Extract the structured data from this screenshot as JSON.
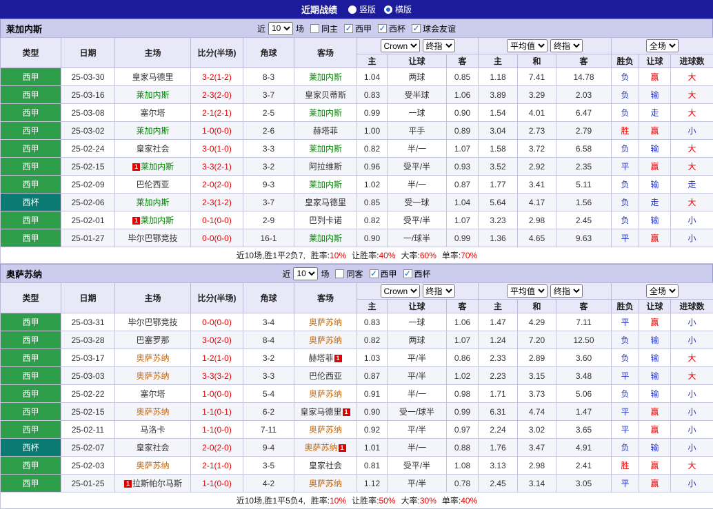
{
  "topbar": {
    "title": "近期战绩",
    "view_options": [
      {
        "label": "竖版",
        "selected": false
      },
      {
        "label": "横版",
        "selected": true
      }
    ]
  },
  "colors": {
    "topbar": "#1b1b9c",
    "league": {
      "西甲": "#2e9e4a",
      "西杯": "#0a7a72"
    },
    "score": "#e80000",
    "result_red": "#e80000",
    "result_blue": "#2233cc",
    "badge": "#e00000",
    "summary_value": "#e80000"
  },
  "table_header": {
    "static_cols": [
      "类型",
      "日期",
      "主场",
      "比分(半场)",
      "角球",
      "客场"
    ],
    "asian_selects": [
      "Crown",
      "终指"
    ],
    "asian_cols": [
      "主",
      "让球",
      "客"
    ],
    "euro_selects": [
      "平均值",
      "终指"
    ],
    "euro_cols": [
      "主",
      "和",
      "客"
    ],
    "result_selects": [
      "全场"
    ],
    "result_cols": [
      "胜负",
      "让球",
      "进球数"
    ]
  },
  "sections": [
    {
      "team": "莱加内斯",
      "team_color": "#008800",
      "filters": {
        "prefix": "近",
        "count": "10",
        "suffix": "场",
        "checkboxes": [
          {
            "label": "同主",
            "checked": false
          },
          {
            "label": "西甲",
            "checked": true
          },
          {
            "label": "西杯",
            "checked": true
          },
          {
            "label": "球会友谊",
            "checked": true
          }
        ]
      },
      "rows": [
        {
          "league": "西甲",
          "date": "25-03-30",
          "home": "皇家马德里",
          "home_tracked": false,
          "home_badge": "",
          "home_badge_side": "",
          "score": "3-2(1-2)",
          "corners": "8-3",
          "away": "莱加内斯",
          "away_tracked": true,
          "away_badge": "",
          "away_badge_side": "",
          "asian": [
            "1.04",
            "两球",
            "0.85"
          ],
          "euro": [
            "1.18",
            "7.41",
            "14.78"
          ],
          "results": [
            [
              "负",
              "b"
            ],
            [
              "赢",
              "r"
            ],
            [
              "大",
              "r"
            ]
          ]
        },
        {
          "league": "西甲",
          "date": "25-03-16",
          "home": "莱加内斯",
          "home_tracked": true,
          "home_badge": "",
          "home_badge_side": "",
          "score": "2-3(2-0)",
          "corners": "3-7",
          "away": "皇家贝蒂斯",
          "away_tracked": false,
          "away_badge": "",
          "away_badge_side": "",
          "asian": [
            "0.83",
            "受半球",
            "1.06"
          ],
          "euro": [
            "3.89",
            "3.29",
            "2.03"
          ],
          "results": [
            [
              "负",
              "b"
            ],
            [
              "输",
              "b"
            ],
            [
              "大",
              "r"
            ]
          ]
        },
        {
          "league": "西甲",
          "date": "25-03-08",
          "home": "塞尔塔",
          "home_tracked": false,
          "home_badge": "",
          "home_badge_side": "",
          "score": "2-1(2-1)",
          "corners": "2-5",
          "away": "莱加内斯",
          "away_tracked": true,
          "away_badge": "",
          "away_badge_side": "",
          "asian": [
            "0.99",
            "一球",
            "0.90"
          ],
          "euro": [
            "1.54",
            "4.01",
            "6.47"
          ],
          "results": [
            [
              "负",
              "b"
            ],
            [
              "走",
              "b"
            ],
            [
              "大",
              "r"
            ]
          ]
        },
        {
          "league": "西甲",
          "date": "25-03-02",
          "home": "莱加内斯",
          "home_tracked": true,
          "home_badge": "",
          "home_badge_side": "",
          "score": "1-0(0-0)",
          "corners": "2-6",
          "away": "赫塔菲",
          "away_tracked": false,
          "away_badge": "",
          "away_badge_side": "",
          "asian": [
            "1.00",
            "平手",
            "0.89"
          ],
          "euro": [
            "3.04",
            "2.73",
            "2.79"
          ],
          "results": [
            [
              "胜",
              "r"
            ],
            [
              "赢",
              "r"
            ],
            [
              "小",
              "b"
            ]
          ]
        },
        {
          "league": "西甲",
          "date": "25-02-24",
          "home": "皇家社会",
          "home_tracked": false,
          "home_badge": "",
          "home_badge_side": "",
          "score": "3-0(1-0)",
          "corners": "3-3",
          "away": "莱加内斯",
          "away_tracked": true,
          "away_badge": "",
          "away_badge_side": "",
          "asian": [
            "0.82",
            "半/一",
            "1.07"
          ],
          "euro": [
            "1.58",
            "3.72",
            "6.58"
          ],
          "results": [
            [
              "负",
              "b"
            ],
            [
              "输",
              "b"
            ],
            [
              "大",
              "r"
            ]
          ]
        },
        {
          "league": "西甲",
          "date": "25-02-15",
          "home": "莱加内斯",
          "home_tracked": true,
          "home_badge": "1",
          "home_badge_side": "l",
          "score": "3-3(2-1)",
          "corners": "3-2",
          "away": "阿拉维斯",
          "away_tracked": false,
          "away_badge": "",
          "away_badge_side": "",
          "asian": [
            "0.96",
            "受平/半",
            "0.93"
          ],
          "euro": [
            "3.52",
            "2.92",
            "2.35"
          ],
          "results": [
            [
              "平",
              "b"
            ],
            [
              "赢",
              "r"
            ],
            [
              "大",
              "r"
            ]
          ]
        },
        {
          "league": "西甲",
          "date": "25-02-09",
          "home": "巴伦西亚",
          "home_tracked": false,
          "home_badge": "",
          "home_badge_side": "",
          "score": "2-0(2-0)",
          "corners": "9-3",
          "away": "莱加内斯",
          "away_tracked": true,
          "away_badge": "",
          "away_badge_side": "",
          "asian": [
            "1.02",
            "半/一",
            "0.87"
          ],
          "euro": [
            "1.77",
            "3.41",
            "5.11"
          ],
          "results": [
            [
              "负",
              "b"
            ],
            [
              "输",
              "b"
            ],
            [
              "走",
              "b"
            ]
          ]
        },
        {
          "league": "西杯",
          "date": "25-02-06",
          "home": "莱加内斯",
          "home_tracked": true,
          "home_badge": "",
          "home_badge_side": "",
          "score": "2-3(1-2)",
          "corners": "3-7",
          "away": "皇家马德里",
          "away_tracked": false,
          "away_badge": "",
          "away_badge_side": "",
          "asian": [
            "0.85",
            "受一球",
            "1.04"
          ],
          "euro": [
            "5.64",
            "4.17",
            "1.56"
          ],
          "results": [
            [
              "负",
              "b"
            ],
            [
              "走",
              "b"
            ],
            [
              "大",
              "r"
            ]
          ]
        },
        {
          "league": "西甲",
          "date": "25-02-01",
          "home": "莱加内斯",
          "home_tracked": true,
          "home_badge": "1",
          "home_badge_side": "l",
          "score": "0-1(0-0)",
          "corners": "2-9",
          "away": "巴列卡诺",
          "away_tracked": false,
          "away_badge": "",
          "away_badge_side": "",
          "asian": [
            "0.82",
            "受平/半",
            "1.07"
          ],
          "euro": [
            "3.23",
            "2.98",
            "2.45"
          ],
          "results": [
            [
              "负",
              "b"
            ],
            [
              "输",
              "b"
            ],
            [
              "小",
              "b"
            ]
          ]
        },
        {
          "league": "西甲",
          "date": "25-01-27",
          "home": "毕尔巴鄂竞技",
          "home_tracked": false,
          "home_badge": "",
          "home_badge_side": "",
          "score": "0-0(0-0)",
          "corners": "16-1",
          "away": "莱加内斯",
          "away_tracked": true,
          "away_badge": "",
          "away_badge_side": "",
          "asian": [
            "0.90",
            "一/球半",
            "0.99"
          ],
          "euro": [
            "1.36",
            "4.65",
            "9.63"
          ],
          "results": [
            [
              "平",
              "b"
            ],
            [
              "赢",
              "r"
            ],
            [
              "小",
              "b"
            ]
          ]
        }
      ],
      "summary": {
        "record": "近10场,胜1平2负7,",
        "stats": [
          {
            "label": "胜率:",
            "value": "10%"
          },
          {
            "label": "让胜率:",
            "value": "40%"
          },
          {
            "label": "大率:",
            "value": "60%"
          },
          {
            "label": "单率:",
            "value": "70%"
          }
        ]
      }
    },
    {
      "team": "奥萨苏纳",
      "team_color": "#cc6600",
      "filters": {
        "prefix": "近",
        "count": "10",
        "suffix": "场",
        "checkboxes": [
          {
            "label": "同客",
            "checked": false
          },
          {
            "label": "西甲",
            "checked": true
          },
          {
            "label": "西杯",
            "checked": true
          }
        ]
      },
      "rows": [
        {
          "league": "西甲",
          "date": "25-03-31",
          "home": "毕尔巴鄂竞技",
          "home_tracked": false,
          "home_badge": "",
          "home_badge_side": "",
          "score": "0-0(0-0)",
          "corners": "3-4",
          "away": "奥萨苏纳",
          "away_tracked": true,
          "away_badge": "",
          "away_badge_side": "",
          "asian": [
            "0.83",
            "一球",
            "1.06"
          ],
          "euro": [
            "1.47",
            "4.29",
            "7.11"
          ],
          "results": [
            [
              "平",
              "b"
            ],
            [
              "赢",
              "r"
            ],
            [
              "小",
              "b"
            ]
          ]
        },
        {
          "league": "西甲",
          "date": "25-03-28",
          "home": "巴塞罗那",
          "home_tracked": false,
          "home_badge": "",
          "home_badge_side": "",
          "score": "3-0(2-0)",
          "corners": "8-4",
          "away": "奥萨苏纳",
          "away_tracked": true,
          "away_badge": "",
          "away_badge_side": "",
          "asian": [
            "0.82",
            "两球",
            "1.07"
          ],
          "euro": [
            "1.24",
            "7.20",
            "12.50"
          ],
          "results": [
            [
              "负",
              "b"
            ],
            [
              "输",
              "b"
            ],
            [
              "小",
              "b"
            ]
          ]
        },
        {
          "league": "西甲",
          "date": "25-03-17",
          "home": "奥萨苏纳",
          "home_tracked": true,
          "home_badge": "",
          "home_badge_side": "",
          "score": "1-2(1-0)",
          "corners": "3-2",
          "away": "赫塔菲",
          "away_tracked": false,
          "away_badge": "1",
          "away_badge_side": "r",
          "asian": [
            "1.03",
            "平/半",
            "0.86"
          ],
          "euro": [
            "2.33",
            "2.89",
            "3.60"
          ],
          "results": [
            [
              "负",
              "b"
            ],
            [
              "输",
              "b"
            ],
            [
              "大",
              "r"
            ]
          ]
        },
        {
          "league": "西甲",
          "date": "25-03-03",
          "home": "奥萨苏纳",
          "home_tracked": true,
          "home_badge": "",
          "home_badge_side": "",
          "score": "3-3(3-2)",
          "corners": "3-3",
          "away": "巴伦西亚",
          "away_tracked": false,
          "away_badge": "",
          "away_badge_side": "",
          "asian": [
            "0.87",
            "平/半",
            "1.02"
          ],
          "euro": [
            "2.23",
            "3.15",
            "3.48"
          ],
          "results": [
            [
              "平",
              "b"
            ],
            [
              "输",
              "b"
            ],
            [
              "大",
              "r"
            ]
          ]
        },
        {
          "league": "西甲",
          "date": "25-02-22",
          "home": "塞尔塔",
          "home_tracked": false,
          "home_badge": "",
          "home_badge_side": "",
          "score": "1-0(0-0)",
          "corners": "5-4",
          "away": "奥萨苏纳",
          "away_tracked": true,
          "away_badge": "",
          "away_badge_side": "",
          "asian": [
            "0.91",
            "半/一",
            "0.98"
          ],
          "euro": [
            "1.71",
            "3.73",
            "5.06"
          ],
          "results": [
            [
              "负",
              "b"
            ],
            [
              "输",
              "b"
            ],
            [
              "小",
              "b"
            ]
          ]
        },
        {
          "league": "西甲",
          "date": "25-02-15",
          "home": "奥萨苏纳",
          "home_tracked": true,
          "home_badge": "",
          "home_badge_side": "",
          "score": "1-1(0-1)",
          "corners": "6-2",
          "away": "皇家马德里",
          "away_tracked": false,
          "away_badge": "1",
          "away_badge_side": "r",
          "asian": [
            "0.90",
            "受一/球半",
            "0.99"
          ],
          "euro": [
            "6.31",
            "4.74",
            "1.47"
          ],
          "results": [
            [
              "平",
              "b"
            ],
            [
              "赢",
              "r"
            ],
            [
              "小",
              "b"
            ]
          ]
        },
        {
          "league": "西甲",
          "date": "25-02-11",
          "home": "马洛卡",
          "home_tracked": false,
          "home_badge": "",
          "home_badge_side": "",
          "score": "1-1(0-0)",
          "corners": "7-11",
          "away": "奥萨苏纳",
          "away_tracked": true,
          "away_badge": "",
          "away_badge_side": "",
          "asian": [
            "0.92",
            "平/半",
            "0.97"
          ],
          "euro": [
            "2.24",
            "3.02",
            "3.65"
          ],
          "results": [
            [
              "平",
              "b"
            ],
            [
              "赢",
              "r"
            ],
            [
              "小",
              "b"
            ]
          ]
        },
        {
          "league": "西杯",
          "date": "25-02-07",
          "home": "皇家社会",
          "home_tracked": false,
          "home_badge": "",
          "home_badge_side": "",
          "score": "2-0(2-0)",
          "corners": "9-4",
          "away": "奥萨苏纳",
          "away_tracked": true,
          "away_badge": "1",
          "away_badge_side": "r",
          "asian": [
            "1.01",
            "半/一",
            "0.88"
          ],
          "euro": [
            "1.76",
            "3.47",
            "4.91"
          ],
          "results": [
            [
              "负",
              "b"
            ],
            [
              "输",
              "b"
            ],
            [
              "小",
              "b"
            ]
          ]
        },
        {
          "league": "西甲",
          "date": "25-02-03",
          "home": "奥萨苏纳",
          "home_tracked": true,
          "home_badge": "",
          "home_badge_side": "",
          "score": "2-1(1-0)",
          "corners": "3-5",
          "away": "皇家社会",
          "away_tracked": false,
          "away_badge": "",
          "away_badge_side": "",
          "asian": [
            "0.81",
            "受平/半",
            "1.08"
          ],
          "euro": [
            "3.13",
            "2.98",
            "2.41"
          ],
          "results": [
            [
              "胜",
              "r"
            ],
            [
              "赢",
              "r"
            ],
            [
              "大",
              "r"
            ]
          ]
        },
        {
          "league": "西甲",
          "date": "25-01-25",
          "home": "拉斯帕尔马斯",
          "home_tracked": false,
          "home_badge": "1",
          "home_badge_side": "l",
          "score": "1-1(0-0)",
          "corners": "4-2",
          "away": "奥萨苏纳",
          "away_tracked": true,
          "away_badge": "",
          "away_badge_side": "",
          "asian": [
            "1.12",
            "平/半",
            "0.78"
          ],
          "euro": [
            "2.45",
            "3.14",
            "3.05"
          ],
          "results": [
            [
              "平",
              "b"
            ],
            [
              "赢",
              "r"
            ],
            [
              "小",
              "b"
            ]
          ]
        }
      ],
      "summary": {
        "record": "近10场,胜1平5负4,",
        "stats": [
          {
            "label": "胜率:",
            "value": "10%"
          },
          {
            "label": "让胜率:",
            "value": "50%"
          },
          {
            "label": "大率:",
            "value": "30%"
          },
          {
            "label": "单率:",
            "value": "40%"
          }
        ]
      }
    }
  ]
}
